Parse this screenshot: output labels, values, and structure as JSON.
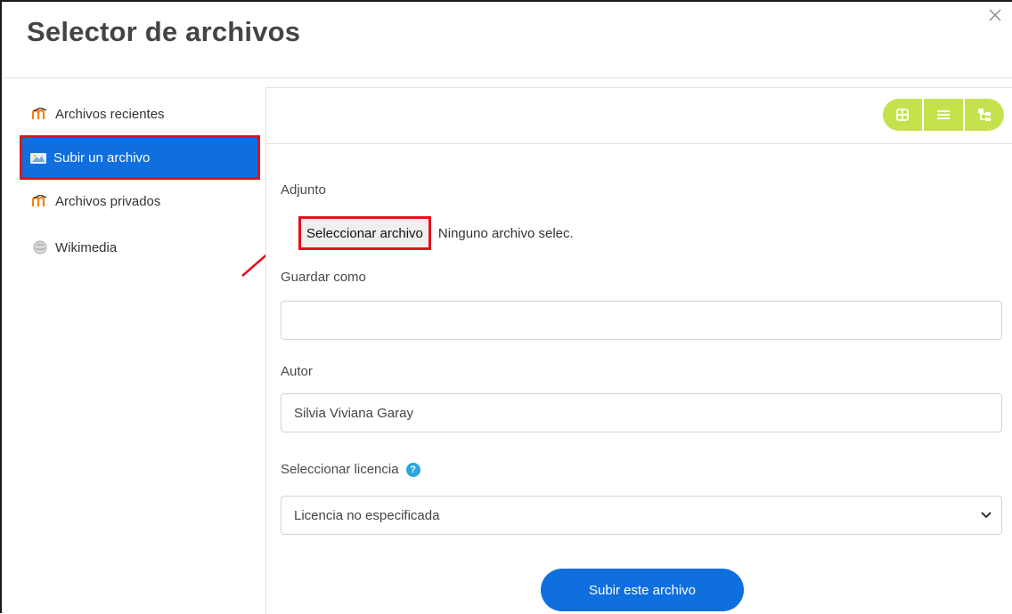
{
  "dialog": {
    "title": "Selector de archivos"
  },
  "sidebar": {
    "items": [
      {
        "label": "Archivos recientes",
        "icon": "moodle-icon",
        "active": false
      },
      {
        "label": "Subir un archivo",
        "icon": "upload-icon",
        "active": true
      },
      {
        "label": "Archivos privados",
        "icon": "moodle-icon",
        "active": false
      },
      {
        "label": "Wikimedia",
        "icon": "wikimedia-icon",
        "active": false
      }
    ]
  },
  "toolbar": {
    "view_buttons": [
      "grid-view-icon",
      "list-view-icon",
      "tree-view-icon"
    ]
  },
  "form": {
    "attachment_label": "Adjunto",
    "choose_file_button": "Seleccionar archivo",
    "no_file_text": "Ninguno archivo selec.",
    "save_as_label": "Guardar como",
    "save_as_value": "",
    "author_label": "Autor",
    "author_value": "Silvia Viviana Garay",
    "license_label": "Seleccionar licencia",
    "license_value": "Licencia no especificada",
    "help_glyph": "?",
    "upload_button": "Subir este archivo"
  },
  "colors": {
    "accent": "#0f6fde",
    "highlight_border": "#e3101d",
    "view_buttons": "#c5e24c",
    "help_icon": "#28a7e0"
  }
}
